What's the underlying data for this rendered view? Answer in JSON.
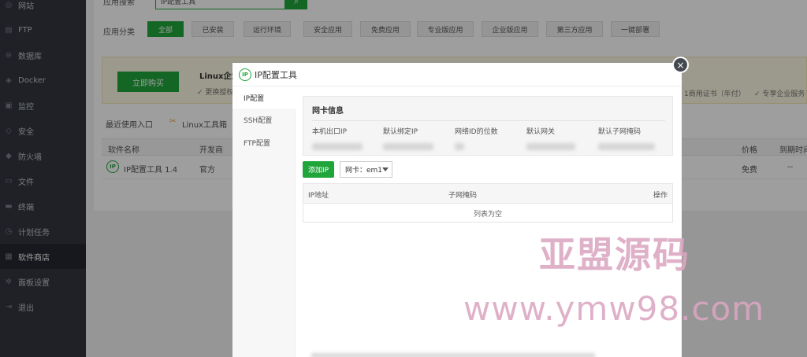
{
  "sidebar": {
    "items": [
      {
        "label": "网站",
        "icon": "globe-icon",
        "glyph": "◎"
      },
      {
        "label": "FTP",
        "icon": "ftp-icon",
        "glyph": "▤"
      },
      {
        "label": "数据库",
        "icon": "database-icon",
        "glyph": "⊜"
      },
      {
        "label": "Docker",
        "icon": "docker-icon",
        "glyph": "◈"
      },
      {
        "label": "监控",
        "icon": "monitor-icon",
        "glyph": "▣"
      },
      {
        "label": "安全",
        "icon": "shield-icon",
        "glyph": "◇"
      },
      {
        "label": "防火墙",
        "icon": "firewall-icon",
        "glyph": "◆"
      },
      {
        "label": "文件",
        "icon": "folder-icon",
        "glyph": "▭"
      },
      {
        "label": "终端",
        "icon": "terminal-icon",
        "glyph": "▬"
      },
      {
        "label": "计划任务",
        "icon": "clock-icon",
        "glyph": "◷"
      },
      {
        "label": "软件商店",
        "icon": "grid-icon",
        "glyph": "▦"
      },
      {
        "label": "面板设置",
        "icon": "gear-icon",
        "glyph": "✲"
      },
      {
        "label": "退出",
        "icon": "logout-icon",
        "glyph": "⇥"
      }
    ]
  },
  "store": {
    "search_label": "应用搜索",
    "search_value": "IP配置工具",
    "category_label": "应用分类",
    "categories": [
      "全部",
      "已安装",
      "运行环境",
      "安全应用",
      "免费应用",
      "专业版应用",
      "企业版应用",
      "第三方应用",
      "一键部署"
    ],
    "buy_label": "立即购买",
    "promo_title": "Linux企业",
    "promo_feature_left": "✓ 更换授权",
    "promo_feature_cert": "1商用证书（年付）",
    "promo_feature_service": "✓ 专享企业服务",
    "recent_label": "最近使用入口",
    "recent_item": "Linux工具箱",
    "table_headers": {
      "name": "软件名称",
      "dev": "开发商",
      "price": "价格",
      "expire": "到期时间"
    },
    "row": {
      "name": "IP配置工具 1.4",
      "dev": "官方",
      "price": "免费",
      "expire": "--"
    }
  },
  "modal": {
    "logo_text": "IP",
    "title": "IP配置工具",
    "close_glyph": "×",
    "tabs": [
      "IP配置",
      "SSH配置",
      "FTP配置"
    ],
    "card_title": "网卡信息",
    "card_labels": [
      "本机出口IP",
      "默认绑定IP",
      "网络ID的位数",
      "默认网关",
      "默认子网掩码"
    ],
    "add_ip_label": "添加IP",
    "nic_select": "网卡：em1",
    "table_headers": {
      "ip": "IP地址",
      "mask": "子网掩码",
      "ops": "操作"
    },
    "empty_text": "列表为空"
  },
  "watermark": {
    "line1": "亚盟源码",
    "line2": "www.ymw98.com"
  }
}
